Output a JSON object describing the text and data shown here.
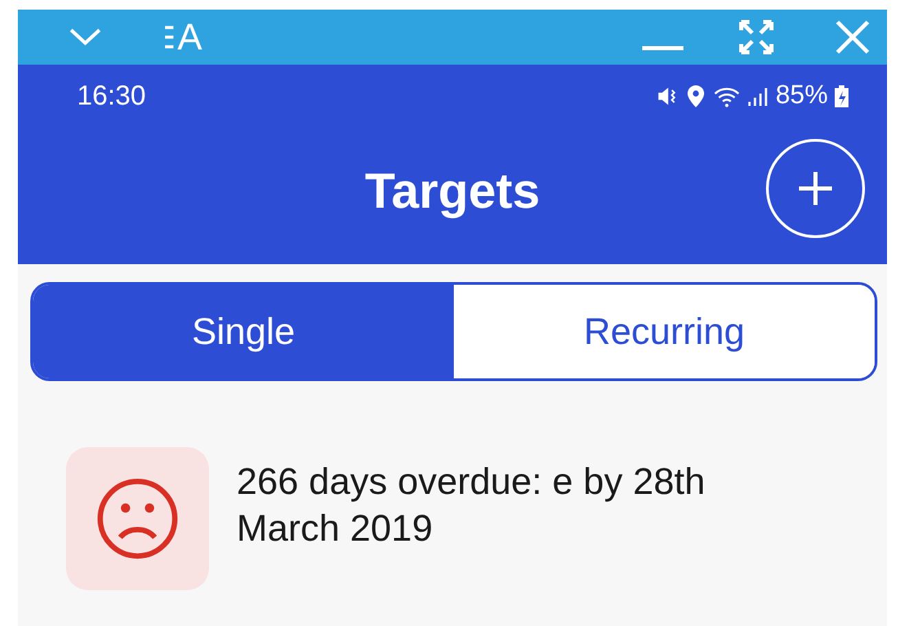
{
  "mirror_bar": {
    "label": "A"
  },
  "status_bar": {
    "time": "16:30",
    "battery": "85%"
  },
  "header": {
    "title": "Targets"
  },
  "tabs": [
    {
      "label": "Single",
      "selected": true
    },
    {
      "label": "Recurring",
      "selected": false
    }
  ],
  "targets": [
    {
      "text": "266 days overdue: e by 28th March 2019",
      "overdue": true
    }
  ]
}
